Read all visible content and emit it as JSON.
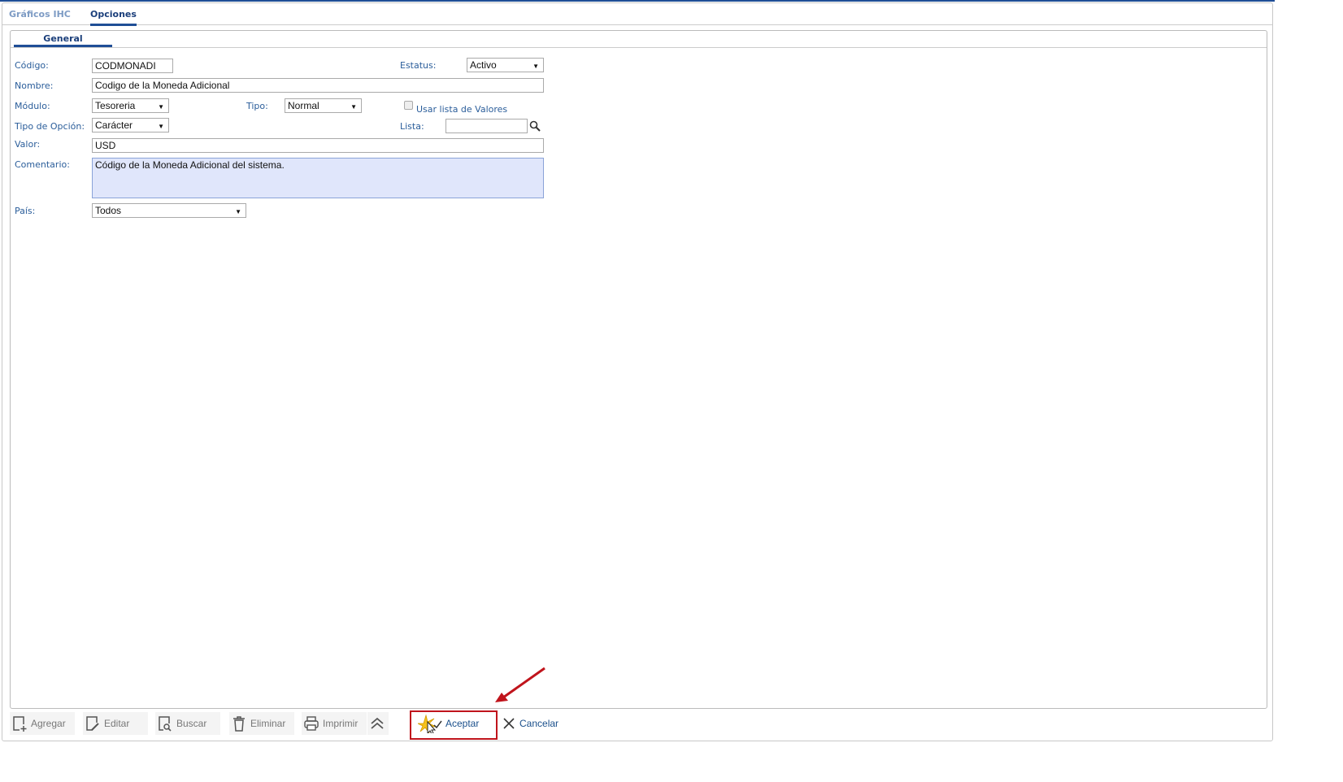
{
  "tabs": [
    "Gráficos IHC",
    "Opciones"
  ],
  "subtab": "General",
  "form": {
    "codigo_label": "Código:",
    "codigo": "CODMONADI",
    "estatus_label": "Estatus:",
    "estatus": "Activo",
    "nombre_label": "Nombre:",
    "nombre": "Codigo de la Moneda Adicional",
    "modulo_label": "Módulo:",
    "modulo": "Tesoreria",
    "tipo_label": "Tipo:",
    "tipo": "Normal",
    "usar_lista_label": "Usar lista de Valores",
    "tipo_opcion_label": "Tipo de Opción:",
    "tipo_opcion": "Carácter",
    "lista_label": "Lista:",
    "lista": "",
    "valor_label": "Valor:",
    "valor": "USD",
    "comentario_label": "Comentario:",
    "comentario": "Código de la Moneda Adicional del sistema.",
    "pais_label": "País:",
    "pais": "Todos"
  },
  "toolbar": {
    "agregar": "Agregar",
    "editar": "Editar",
    "buscar": "Buscar",
    "eliminar": "Eliminar",
    "imprimir": "Imprimir",
    "aceptar": "Aceptar",
    "cancelar": "Cancelar"
  },
  "colors": {
    "accent": "#1f4e96",
    "highlight": "#c0141c"
  }
}
